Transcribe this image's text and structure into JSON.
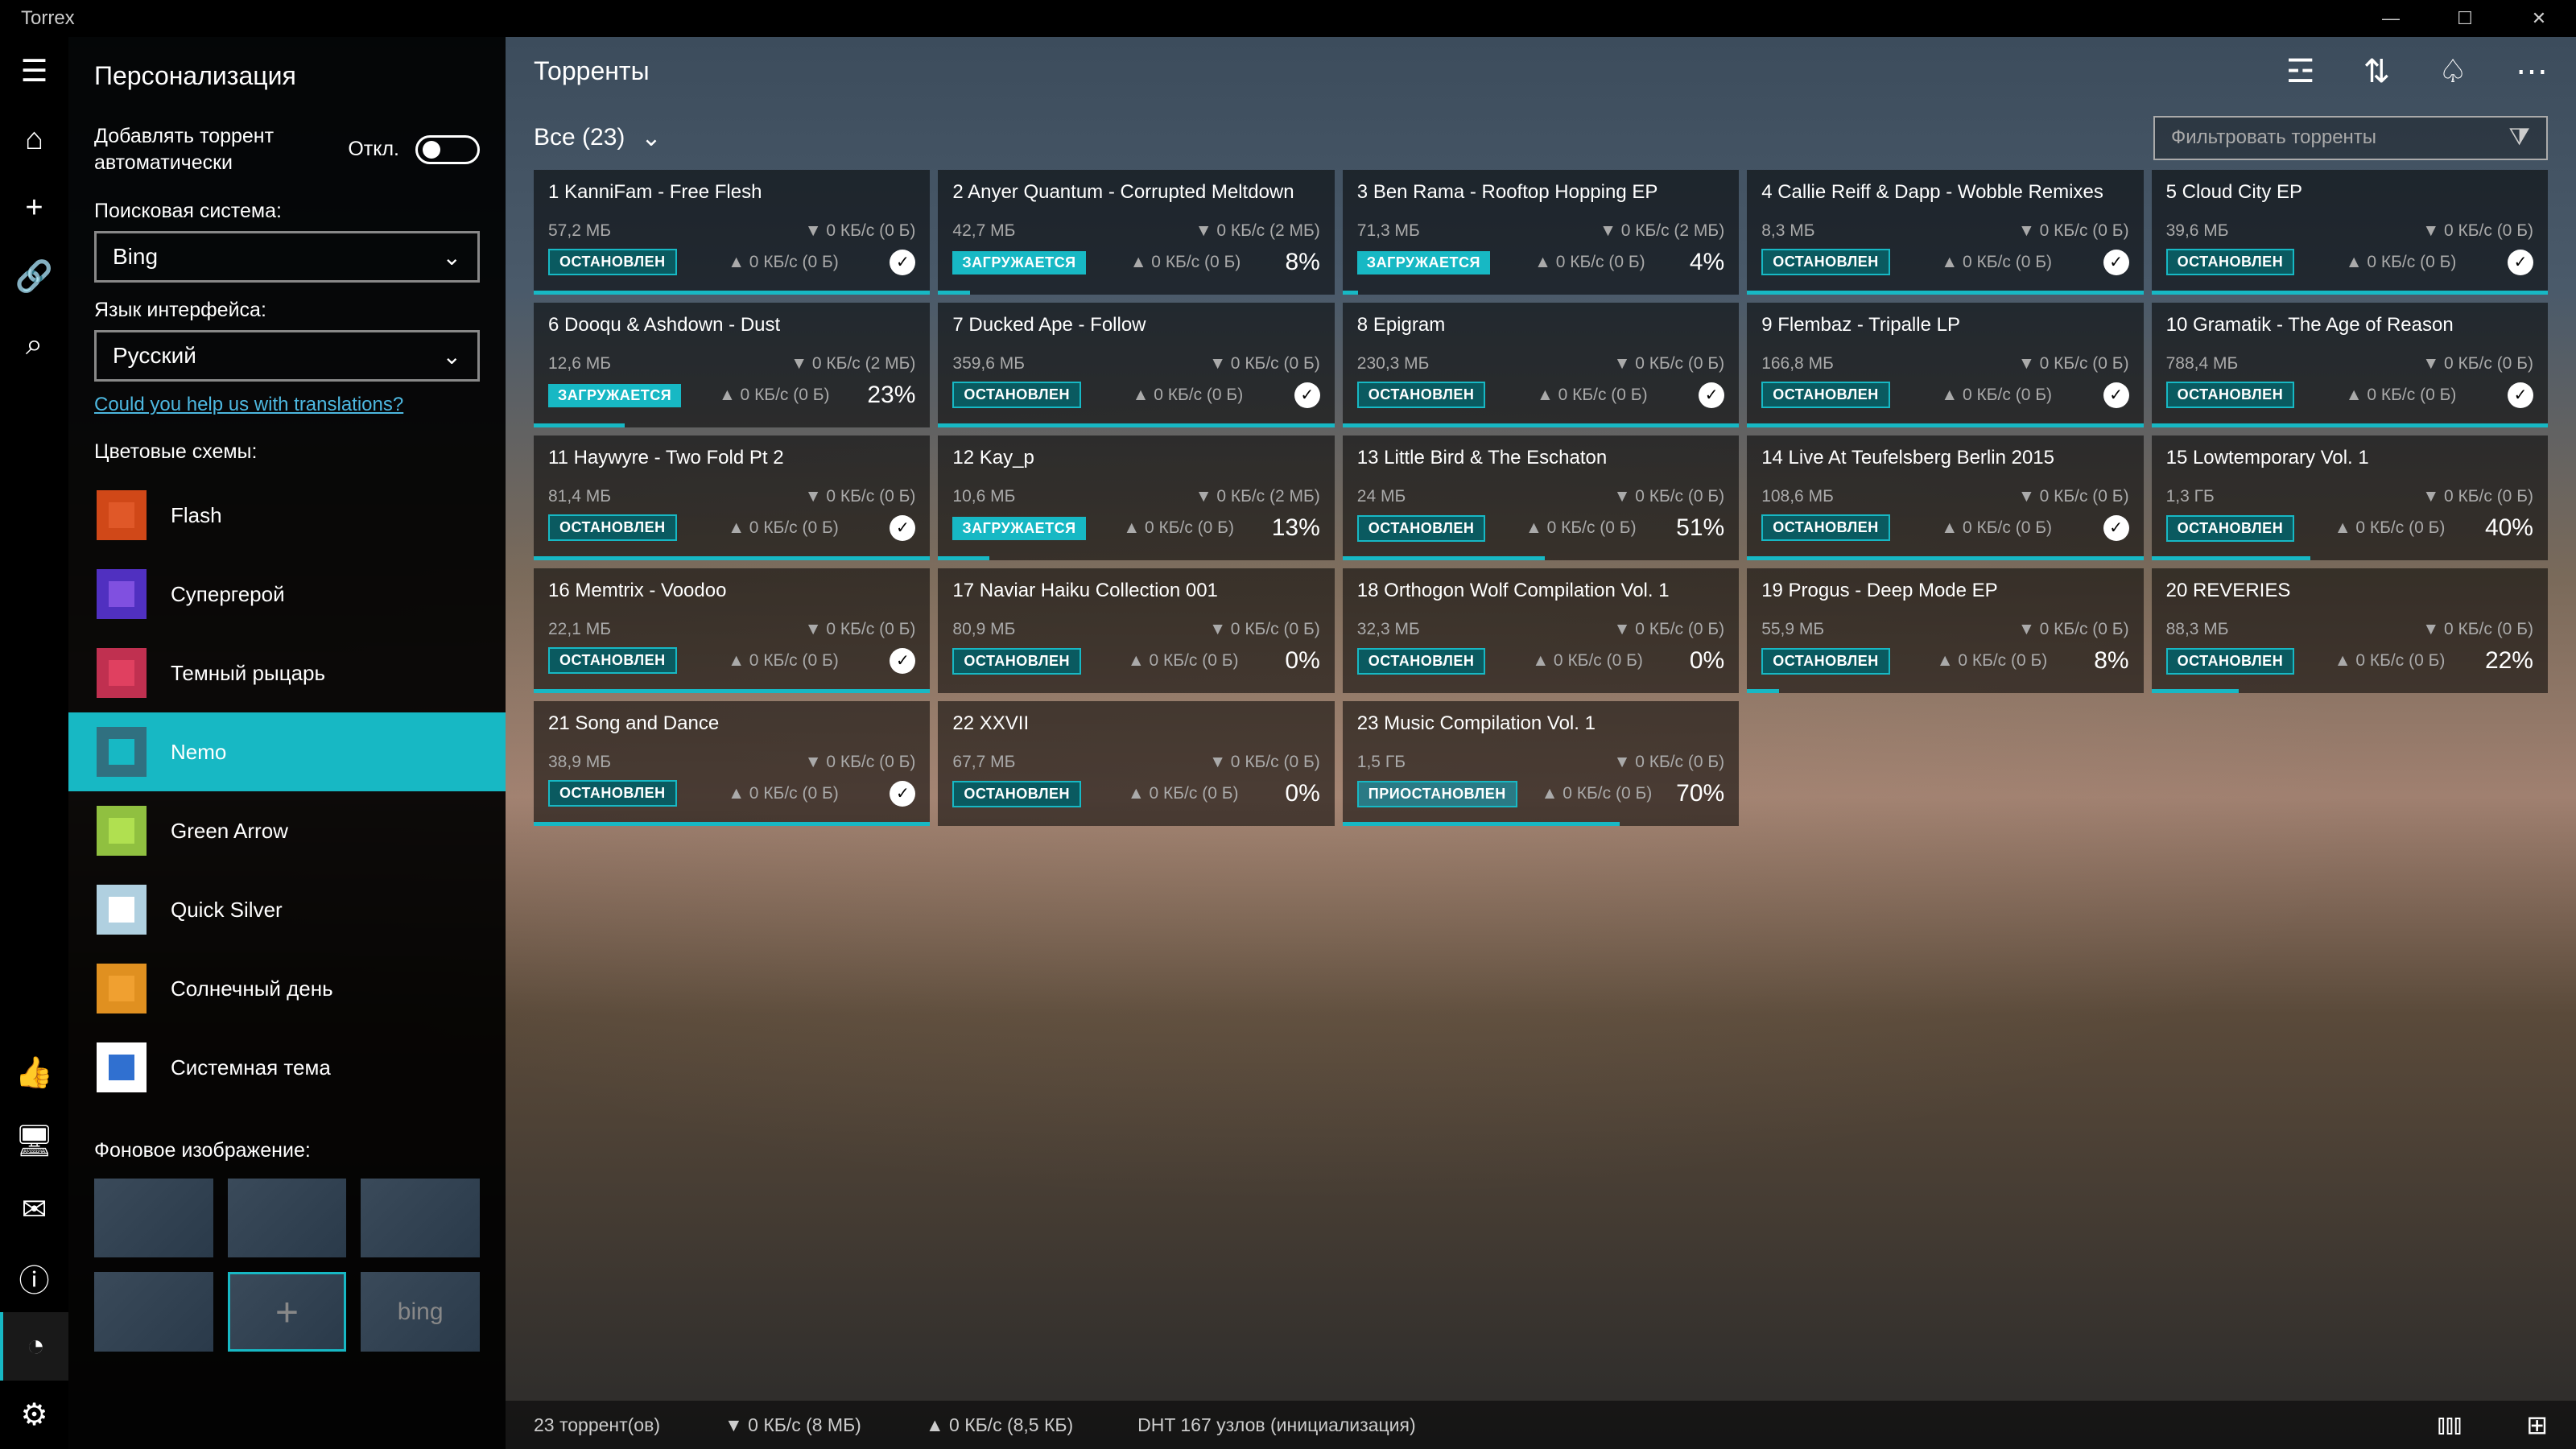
{
  "app": {
    "title": "Torrex"
  },
  "titlebar": {
    "minimize": "—",
    "maximize": "☐",
    "close": "✕"
  },
  "nav": {
    "menu": "☰",
    "home": "⌂",
    "add": "+",
    "link": "🔗",
    "search": "⌕",
    "like": "👍",
    "device": "🖥",
    "mail": "✉",
    "info": "ⓘ",
    "theme": "◔",
    "settings": "⚙"
  },
  "settings": {
    "title": "Персонализация",
    "auto_add_label": "Добавлять торрент автоматически",
    "toggle_off": "Откл.",
    "search_engine_label": "Поисковая система:",
    "search_engine_value": "Bing",
    "lang_label": "Язык интерфейса:",
    "lang_value": "Русский",
    "help_link": "Could you help us with translations?",
    "schemes_label": "Цветовые схемы:",
    "schemes": [
      {
        "name": "Flash",
        "outer": "#d04818",
        "inner": "#e05828"
      },
      {
        "name": "Супергерой",
        "outer": "#5030c0",
        "inner": "#8050e0"
      },
      {
        "name": "Темный рыцарь",
        "outer": "#c03050",
        "inner": "#e04060"
      },
      {
        "name": "Nemo",
        "outer": "#307080",
        "inner": "#17b8c4",
        "selected": true
      },
      {
        "name": "Green Arrow",
        "outer": "#90c040",
        "inner": "#b0e050"
      },
      {
        "name": "Quick Silver",
        "outer": "#b0d0e0",
        "inner": "#ffffff"
      },
      {
        "name": "Солнечный день",
        "outer": "#e09020",
        "inner": "#f0a030"
      },
      {
        "name": "Системная тема",
        "outer": "#ffffff",
        "inner": "#3070d0"
      }
    ],
    "bg_label": "Фоновое изображение:",
    "bg_add": "+",
    "bg_bing": "bing"
  },
  "main": {
    "title": "Торренты",
    "filter_label": "Все (23)",
    "search_placeholder": "Фильтровать торренты"
  },
  "status_labels": {
    "stopped": "ОСТАНОВЛЕН",
    "loading": "ЗАГРУЖАЕТСЯ",
    "paused": "ПРИОСТАНОВЛЕН"
  },
  "torrents": [
    {
      "n": 1,
      "title": "KanniFam - Free Flesh",
      "size": "57,2 МБ",
      "down": "0 КБ/с (0 Б)",
      "up": "0 КБ/с (0 Б)",
      "status": "stopped",
      "complete": true,
      "progress": 100
    },
    {
      "n": 2,
      "title": "Anyer Quantum - Corrupted Meltdown",
      "size": "42,7 МБ",
      "down": "0 КБ/с (2 МБ)",
      "up": "0 КБ/с (0 Б)",
      "status": "loading",
      "percent": "8%",
      "progress": 8
    },
    {
      "n": 3,
      "title": "Ben Rama - Rooftop Hopping EP",
      "size": "71,3 МБ",
      "down": "0 КБ/с (2 МБ)",
      "up": "0 КБ/с (0 Б)",
      "status": "loading",
      "percent": "4%",
      "progress": 4
    },
    {
      "n": 4,
      "title": "Callie Reiff & Dapp - Wobble Remixes",
      "size": "8,3 МБ",
      "down": "0 КБ/с (0 Б)",
      "up": "0 КБ/с (0 Б)",
      "status": "stopped",
      "complete": true,
      "progress": 100
    },
    {
      "n": 5,
      "title": "Cloud City EP",
      "size": "39,6 МБ",
      "down": "0 КБ/с (0 Б)",
      "up": "0 КБ/с (0 Б)",
      "status": "stopped",
      "complete": true,
      "progress": 100
    },
    {
      "n": 6,
      "title": "Dooqu & Ashdown - Dust",
      "size": "12,6 МБ",
      "down": "0 КБ/с (2 МБ)",
      "up": "0 КБ/с (0 Б)",
      "status": "loading",
      "percent": "23%",
      "progress": 23
    },
    {
      "n": 7,
      "title": "Ducked Ape - Follow",
      "size": "359,6 МБ",
      "down": "0 КБ/с (0 Б)",
      "up": "0 КБ/с (0 Б)",
      "status": "stopped",
      "complete": true,
      "progress": 100
    },
    {
      "n": 8,
      "title": "Epigram",
      "size": "230,3 МБ",
      "down": "0 КБ/с (0 Б)",
      "up": "0 КБ/с (0 Б)",
      "status": "stopped",
      "complete": true,
      "progress": 100
    },
    {
      "n": 9,
      "title": "Flembaz - Tripalle LP",
      "size": "166,8 МБ",
      "down": "0 КБ/с (0 Б)",
      "up": "0 КБ/с (0 Б)",
      "status": "stopped",
      "complete": true,
      "progress": 100
    },
    {
      "n": 10,
      "title": "Gramatik - The Age of Reason",
      "size": "788,4 МБ",
      "down": "0 КБ/с (0 Б)",
      "up": "0 КБ/с (0 Б)",
      "status": "stopped",
      "complete": true,
      "progress": 100
    },
    {
      "n": 11,
      "title": "Haywyre - Two Fold Pt 2",
      "size": "81,4 МБ",
      "down": "0 КБ/с (0 Б)",
      "up": "0 КБ/с (0 Б)",
      "status": "stopped",
      "complete": true,
      "progress": 100
    },
    {
      "n": 12,
      "title": "Kay_p",
      "size": "10,6 МБ",
      "down": "0 КБ/с (2 МБ)",
      "up": "0 КБ/с (0 Б)",
      "status": "loading",
      "percent": "13%",
      "progress": 13
    },
    {
      "n": 13,
      "title": "Little Bird & The Eschaton",
      "size": "24 МБ",
      "down": "0 КБ/с (0 Б)",
      "up": "0 КБ/с (0 Б)",
      "status": "stopped",
      "percent": "51%",
      "progress": 51
    },
    {
      "n": 14,
      "title": "Live At Teufelsberg Berlin 2015",
      "size": "108,6 МБ",
      "down": "0 КБ/с (0 Б)",
      "up": "0 КБ/с (0 Б)",
      "status": "stopped",
      "complete": true,
      "progress": 100
    },
    {
      "n": 15,
      "title": "Lowtemporary Vol. 1",
      "size": "1,3 ГБ",
      "down": "0 КБ/с (0 Б)",
      "up": "0 КБ/с (0 Б)",
      "status": "stopped",
      "percent": "40%",
      "progress": 40
    },
    {
      "n": 16,
      "title": "Memtrix - Voodoo",
      "size": "22,1 МБ",
      "down": "0 КБ/с (0 Б)",
      "up": "0 КБ/с (0 Б)",
      "status": "stopped",
      "complete": true,
      "progress": 100
    },
    {
      "n": 17,
      "title": "Naviar Haiku Collection 001",
      "size": "80,9 МБ",
      "down": "0 КБ/с (0 Б)",
      "up": "0 КБ/с (0 Б)",
      "status": "stopped",
      "percent": "0%",
      "progress": 0
    },
    {
      "n": 18,
      "title": "Orthogon Wolf Compilation Vol. 1",
      "size": "32,3 МБ",
      "down": "0 КБ/с (0 Б)",
      "up": "0 КБ/с (0 Б)",
      "status": "stopped",
      "percent": "0%",
      "progress": 0
    },
    {
      "n": 19,
      "title": "Progus - Deep Mode EP",
      "size": "55,9 МБ",
      "down": "0 КБ/с (0 Б)",
      "up": "0 КБ/с (0 Б)",
      "status": "stopped",
      "percent": "8%",
      "progress": 8
    },
    {
      "n": 20,
      "title": "REVERIES",
      "size": "88,3 МБ",
      "down": "0 КБ/с (0 Б)",
      "up": "0 КБ/с (0 Б)",
      "status": "stopped",
      "percent": "22%",
      "progress": 22
    },
    {
      "n": 21,
      "title": "Song and Dance",
      "size": "38,9 МБ",
      "down": "0 КБ/с (0 Б)",
      "up": "0 КБ/с (0 Б)",
      "status": "stopped",
      "complete": true,
      "progress": 100
    },
    {
      "n": 22,
      "title": "XXVII",
      "size": "67,7 МБ",
      "down": "0 КБ/с (0 Б)",
      "up": "0 КБ/с (0 Б)",
      "status": "stopped",
      "percent": "0%",
      "progress": 0
    },
    {
      "n": 23,
      "title": "Music Compilation Vol. 1",
      "size": "1,5 ГБ",
      "down": "0 КБ/с (0 Б)",
      "up": "0 КБ/с (0 Б)",
      "status": "paused",
      "percent": "70%",
      "progress": 70
    }
  ],
  "statusbar": {
    "count": "23 торрент(ов)",
    "down": "▼ 0 КБ/с (8 МБ)",
    "up": "▲ 0 КБ/с (8,5 КБ)",
    "dht": "DHT 167 узлов (инициализация)"
  }
}
